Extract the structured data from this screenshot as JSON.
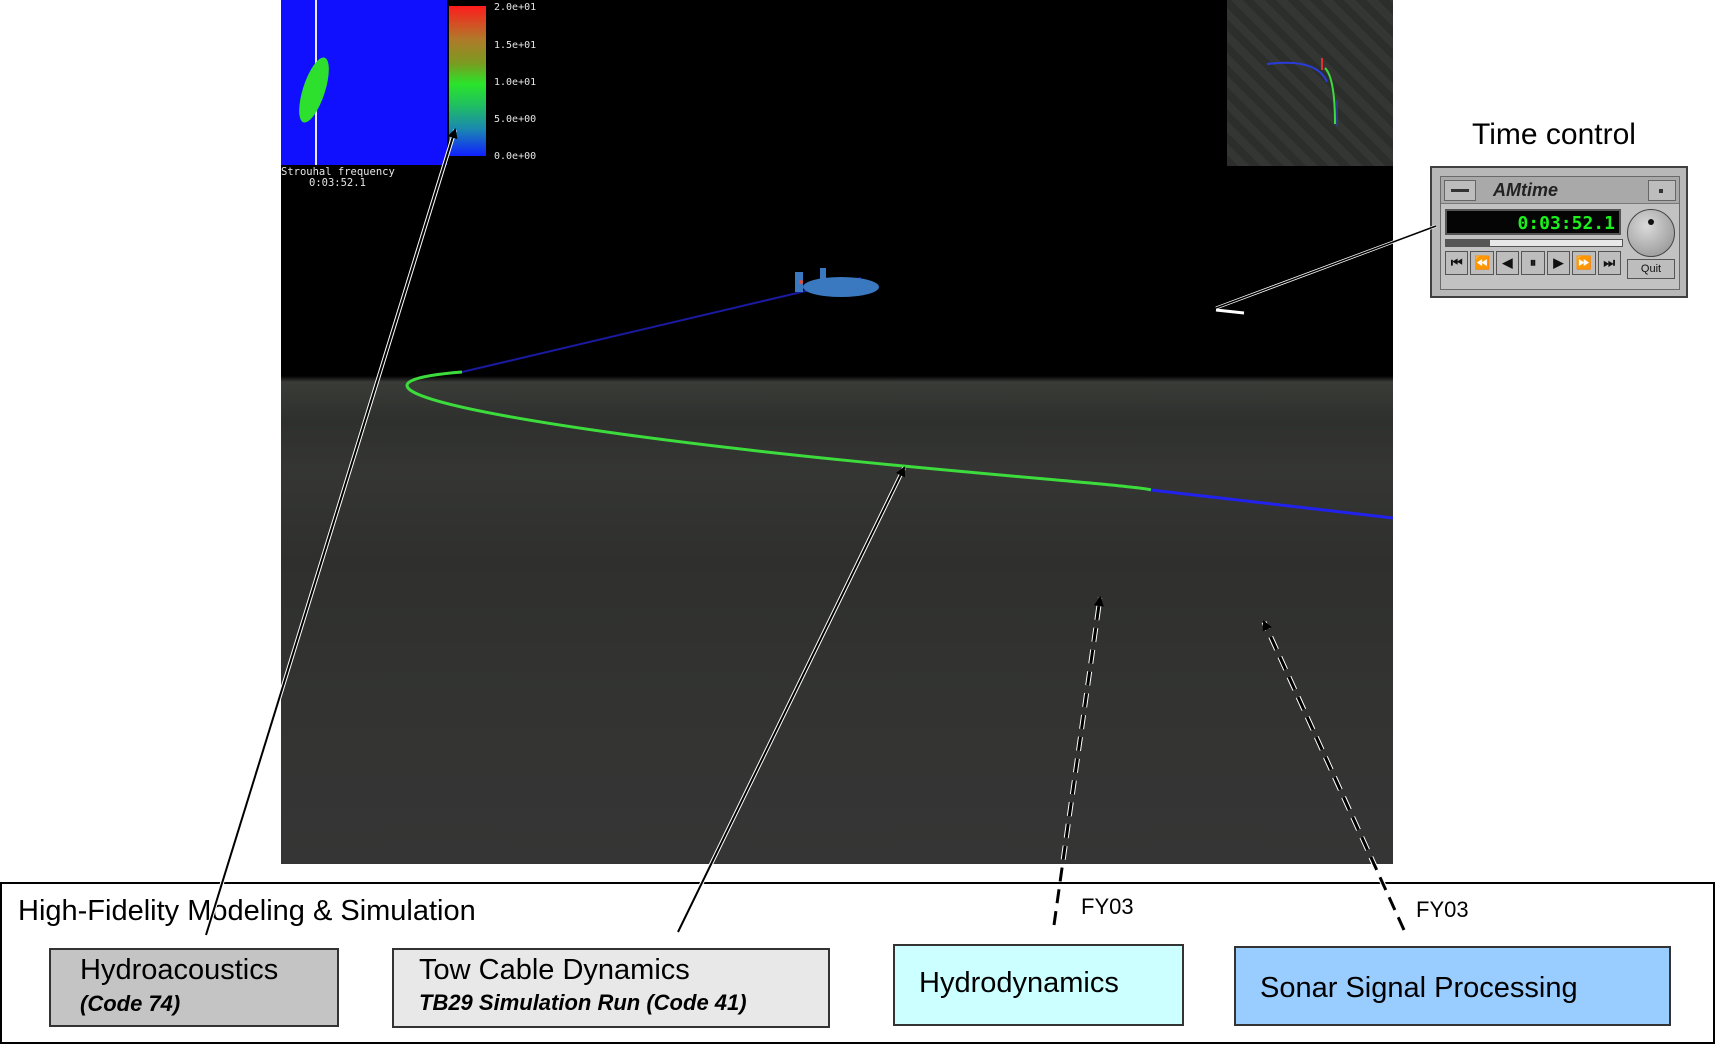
{
  "viewer": {
    "colorbar_ticks": [
      "2.0e+01",
      "1.5e+01",
      "1.0e+01",
      "5.0e+00",
      "0.0e+00"
    ],
    "frequency_title": "Strouhal frequency",
    "frequency_time": "0:03:52.1",
    "colors": {
      "cable_green": "#3ddc3d",
      "cable_blue": "#2222ee",
      "submarine": "#3a78c0"
    }
  },
  "time_control": {
    "label": "Time control",
    "window_title": "AMtime",
    "display_time": "0:03:52.1",
    "progress": 0.25,
    "buttons": [
      "⏮",
      "⏪",
      "◀",
      "⏸",
      "▶",
      "⏩",
      "⏭"
    ],
    "quit_label": "Quit"
  },
  "panel": {
    "title": "High-Fidelity Modeling & Simulation",
    "boxes": [
      {
        "title": "Hydroacoustics",
        "subtitle": "(Code 74)",
        "color": "#c4c4c4"
      },
      {
        "title": "Tow Cable Dynamics",
        "subtitle": "TB29 Simulation Run (Code 41)",
        "color": "#e8e8e8"
      },
      {
        "title": "Hydrodynamics",
        "subtitle": "",
        "color": "#ccffff"
      },
      {
        "title": "Sonar Signal Processing",
        "subtitle": "",
        "color": "#99ccff"
      }
    ],
    "fy_labels": [
      "FY03",
      "FY03"
    ]
  }
}
